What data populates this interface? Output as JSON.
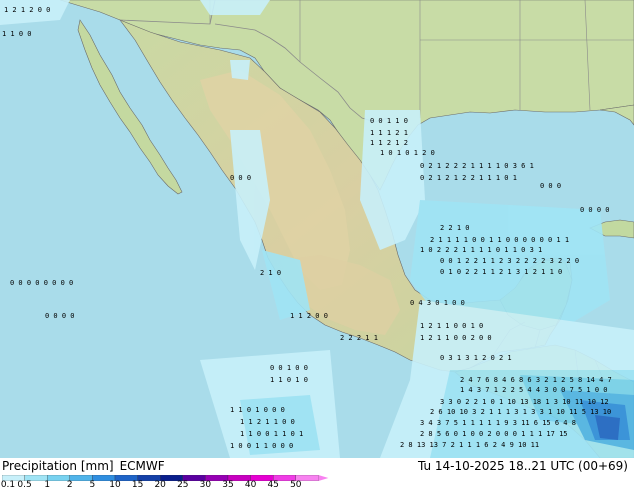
{
  "map": {
    "title": "Precipitation [mm]",
    "model": "ECMWF",
    "valid_time": "Tu 14-10-2025 18..21 UTC (00+69)",
    "colors": {
      "ocean": "#a9dcea",
      "land_lowland": "#b9d8a0",
      "land_highland": "#dcd3a8",
      "border": "#8a8a8a",
      "coast": "#6a6a6a"
    }
  },
  "legend": {
    "ticks": [
      "0.1",
      "0.5",
      "1",
      "2",
      "5",
      "10",
      "15",
      "20",
      "25",
      "30",
      "35",
      "40",
      "45",
      "50"
    ],
    "colors": [
      "#c8f0fa",
      "#a0e4f5",
      "#78d2f0",
      "#50b4ea",
      "#2f8ee0",
      "#1e64c8",
      "#1440a8",
      "#0a1e8c",
      "#5a00a0",
      "#9600b4",
      "#c800c0",
      "#e600d2",
      "#f03ce6",
      "#f882f0"
    ]
  },
  "precip_values": [
    {
      "region": "nw-corner",
      "values": [
        "1",
        "2",
        "1",
        "2",
        "0",
        "0"
      ]
    },
    {
      "region": "gulf-north",
      "values": [
        "0",
        "0",
        "1",
        "1",
        "0"
      ]
    },
    {
      "region": "gulf-tamaulipas",
      "values": [
        "1",
        "1",
        "1",
        "2",
        "1",
        "2",
        "1",
        "0",
        "1",
        "0",
        "1",
        "2",
        "0"
      ]
    },
    {
      "region": "gulf-central",
      "values": [
        "0",
        "2",
        "1",
        "2",
        "2",
        "2",
        "1",
        "1",
        "1",
        "1",
        "0",
        "1",
        "1",
        "0",
        "3",
        "6",
        "1"
      ]
    },
    {
      "region": "gulf-south",
      "values": [
        "1",
        "0",
        "2",
        "2",
        "1",
        "1",
        "3",
        "1",
        "2",
        "3",
        "2",
        "2",
        "2",
        "2",
        "3",
        "2",
        "2",
        "0"
      ]
    },
    {
      "region": "yucatan-west",
      "values": [
        "0",
        "1",
        "0",
        "2",
        "2",
        "1",
        "1",
        "2",
        "1",
        "3",
        "1",
        "2",
        "1",
        "1",
        "0"
      ]
    },
    {
      "region": "pacific-south",
      "values": [
        "1",
        "2",
        "2",
        "1",
        "1",
        "0",
        "0",
        "0",
        "1",
        "0",
        "1",
        "1",
        "2",
        "1"
      ]
    },
    {
      "region": "caribbean",
      "values": [
        "2",
        "4",
        "7",
        "6",
        "8",
        "4",
        "6",
        "8",
        "6",
        "3",
        "2",
        "1",
        "2",
        "5",
        "8",
        "14",
        "4",
        "7"
      ]
    },
    {
      "region": "central-america",
      "values": [
        "2",
        "6",
        "10",
        "10",
        "3",
        "2",
        "1",
        "1",
        "1",
        "3",
        "1",
        "3",
        "3",
        "1",
        "10",
        "11",
        "5",
        "13",
        "10",
        "3",
        "5",
        "5",
        "2"
      ]
    },
    {
      "region": "guatemala",
      "values": [
        "3",
        "4",
        "3",
        "7",
        "5",
        "1",
        "1",
        "1",
        "1",
        "1",
        "9",
        "3",
        "11",
        "6",
        "15",
        "6",
        "4",
        "8",
        "17",
        "15"
      ]
    },
    {
      "region": "pacific-far-south",
      "values": [
        "2",
        "8",
        "13",
        "13",
        "7",
        "2",
        "1",
        "1",
        "1",
        "6",
        "2",
        "4",
        "9",
        "10",
        "11"
      ]
    }
  ]
}
